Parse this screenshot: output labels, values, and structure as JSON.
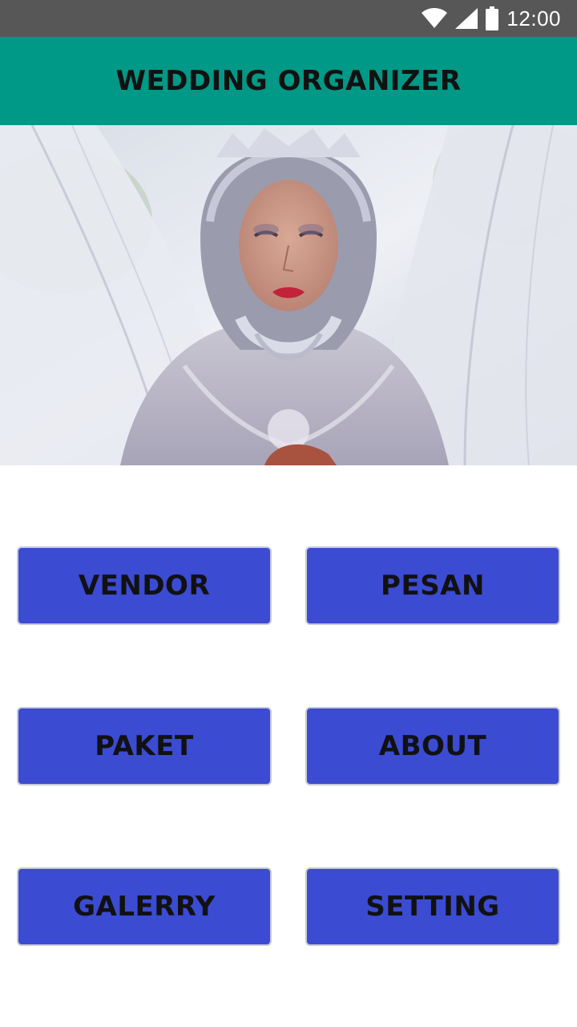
{
  "status_bar": {
    "time": "12:00",
    "icons": [
      "wifi-icon",
      "cell-signal-icon",
      "battery-icon"
    ]
  },
  "app_bar": {
    "title": "WEDDING ORGANIZER",
    "color": "#009886"
  },
  "hero": {
    "image": "bride-photo"
  },
  "menu": {
    "button_color": "#3b4bd2",
    "vendor_label": "VENDOR",
    "pesan_label": "PESAN",
    "paket_label": "PAKET",
    "about_label": "ABOUT",
    "galerry_label": "GALERRY",
    "setting_label": "SETTING"
  }
}
